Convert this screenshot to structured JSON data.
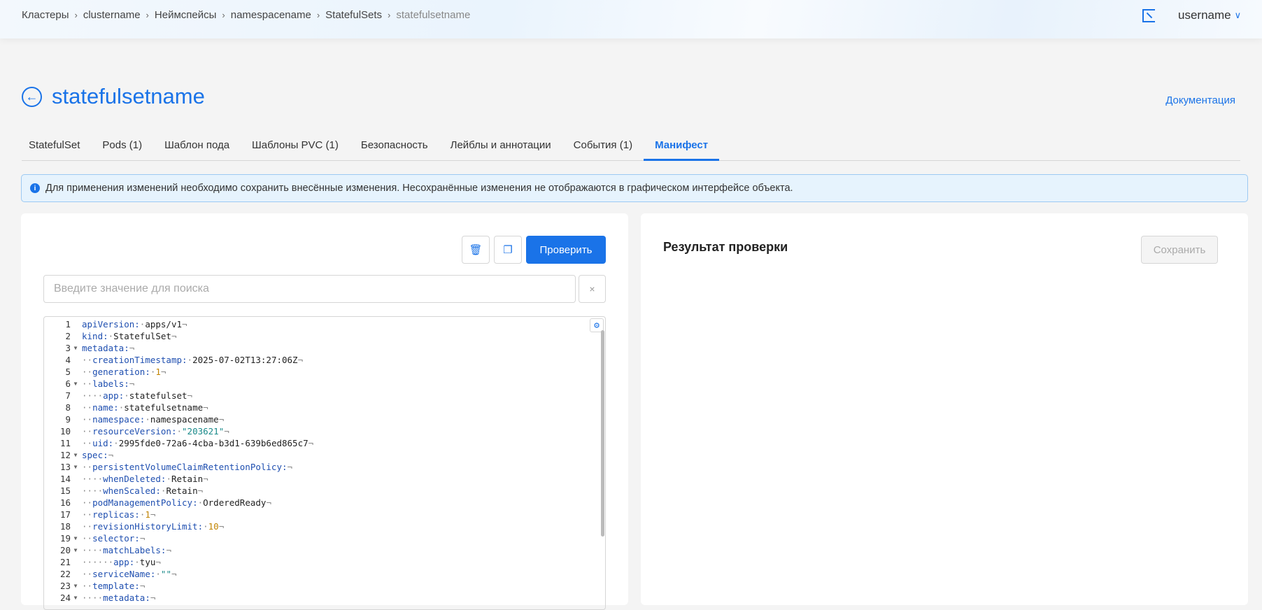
{
  "breadcrumb": [
    "Кластеры",
    "clustername",
    "Неймспейсы",
    "namespacename",
    "StatefulSets",
    "statefulsetname"
  ],
  "user": {
    "name": "username"
  },
  "page": {
    "title": "statefulsetname",
    "docs_link": "Документация"
  },
  "tabs": [
    "StatefulSet",
    "Pods (1)",
    "Шаблон пода",
    "Шаблоны PVC (1)",
    "Безопасность",
    "Лейблы и аннотации",
    "События (1)",
    "Манифест"
  ],
  "active_tab": "Манифест",
  "banner": {
    "text": "Для применения изменений необходимо сохранить внесённые изменения. Несохранённые изменения не отображаются в графическом интерфейсе объекта."
  },
  "editor_panel": {
    "validate_label": "Проверить",
    "search_placeholder": "Введите значение для поиска",
    "clear_label": "×",
    "lines": [
      {
        "n": "1",
        "f": false,
        "i": "",
        "k": "apiVersion",
        "v": "apps/v1",
        "t": "v"
      },
      {
        "n": "2",
        "f": false,
        "i": "",
        "k": "kind",
        "v": "StatefulSet",
        "t": "v"
      },
      {
        "n": "3",
        "f": true,
        "i": "",
        "k": "metadata",
        "v": "",
        "t": "v"
      },
      {
        "n": "4",
        "f": false,
        "i": "··",
        "k": "creationTimestamp",
        "v": "2025-07-02T13:27:06Z",
        "t": "v"
      },
      {
        "n": "5",
        "f": false,
        "i": "··",
        "k": "generation",
        "v": "1",
        "t": "n"
      },
      {
        "n": "6",
        "f": true,
        "i": "··",
        "k": "labels",
        "v": "",
        "t": "v"
      },
      {
        "n": "7",
        "f": false,
        "i": "····",
        "k": "app",
        "v": "statefulset",
        "t": "v"
      },
      {
        "n": "8",
        "f": false,
        "i": "··",
        "k": "name",
        "v": "statefulsetname",
        "t": "v"
      },
      {
        "n": "9",
        "f": false,
        "i": "··",
        "k": "namespace",
        "v": "namespacename",
        "t": "v"
      },
      {
        "n": "10",
        "f": false,
        "i": "··",
        "k": "resourceVersion",
        "v": "\"203621\"",
        "t": "s"
      },
      {
        "n": "11",
        "f": false,
        "i": "··",
        "k": "uid",
        "v": "2995fde0-72a6-4cba-b3d1-639b6ed865c7",
        "t": "v"
      },
      {
        "n": "12",
        "f": true,
        "i": "",
        "k": "spec",
        "v": "",
        "t": "v"
      },
      {
        "n": "13",
        "f": true,
        "i": "··",
        "k": "persistentVolumeClaimRetentionPolicy",
        "v": "",
        "t": "v"
      },
      {
        "n": "14",
        "f": false,
        "i": "····",
        "k": "whenDeleted",
        "v": "Retain",
        "t": "v"
      },
      {
        "n": "15",
        "f": false,
        "i": "····",
        "k": "whenScaled",
        "v": "Retain",
        "t": "v"
      },
      {
        "n": "16",
        "f": false,
        "i": "··",
        "k": "podManagementPolicy",
        "v": "OrderedReady",
        "t": "v"
      },
      {
        "n": "17",
        "f": false,
        "i": "··",
        "k": "replicas",
        "v": "1",
        "t": "n"
      },
      {
        "n": "18",
        "f": false,
        "i": "··",
        "k": "revisionHistoryLimit",
        "v": "10",
        "t": "n"
      },
      {
        "n": "19",
        "f": true,
        "i": "··",
        "k": "selector",
        "v": "",
        "t": "v"
      },
      {
        "n": "20",
        "f": true,
        "i": "····",
        "k": "matchLabels",
        "v": "",
        "t": "v"
      },
      {
        "n": "21",
        "f": false,
        "i": "······",
        "k": "app",
        "v": "tyu",
        "t": "v"
      },
      {
        "n": "22",
        "f": false,
        "i": "··",
        "k": "serviceName",
        "v": "\"\"",
        "t": "s"
      },
      {
        "n": "23",
        "f": true,
        "i": "··",
        "k": "template",
        "v": "",
        "t": "v"
      },
      {
        "n": "24",
        "f": true,
        "i": "····",
        "k": "metadata",
        "v": "",
        "t": "v"
      }
    ]
  },
  "result_panel": {
    "title": "Результат проверки",
    "save_label": "Сохранить"
  },
  "colors": {
    "accent": "#1a73e8",
    "banner_bg": "#e6f3fd",
    "key": "#1f4fb0",
    "number": "#c18401",
    "string": "#1a8a8a"
  }
}
